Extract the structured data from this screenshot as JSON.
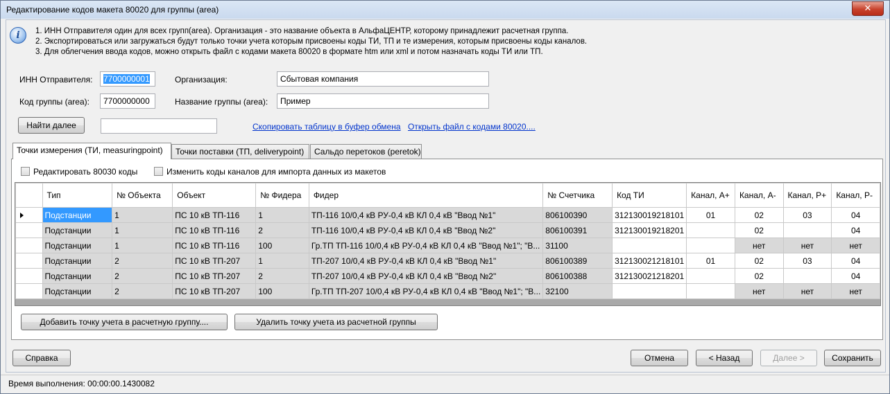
{
  "window": {
    "title": "Редактирование кодов макета 80020 для группы (area)",
    "close_glyph": "✕"
  },
  "info": {
    "icon": "info-icon",
    "icon_glyph": "i",
    "lines": [
      "1. ИНН Отправителя один для всех групп(area). Организация - это название объекта в АльфаЦЕНТР, которому принадлежит расчетная группа.",
      "2. Экспортироваться или загружаться будут только точки учета которым присвоены коды ТИ, ТП и те измерения, которым присвоены коды каналов.",
      "3. Для облегчения ввода кодов, можно открыть файл с кодами макета 80020 в формате htm или xml и потом назначать коды ТИ или ТП."
    ]
  },
  "form": {
    "inn_label": "ИНН Отправителя:",
    "inn_value": "7700000001",
    "org_label": "Организация:",
    "org_value": "Сбытовая компания",
    "area_code_label": "Код группы (area):",
    "area_code_value": "7700000000",
    "area_name_label": "Название группы (area):",
    "area_name_value": "Пример",
    "find_button": "Найти далее",
    "find_value": "",
    "copy_link": "Скопировать таблицу в буфер обмена",
    "open_link": "Открыть файл с кодами 80020...."
  },
  "tabs": [
    "Точки измерения (ТИ, measuringpoint)",
    "Точки поставки (ТП, deliverypoint)",
    "Сальдо перетоков (peretok)"
  ],
  "checkboxes": {
    "edit_80030": "Редактировать 80030 коды",
    "change_channel_codes": "Изменить коды каналов для импорта данных из макетов"
  },
  "table": {
    "columns": [
      "Тип",
      "№ Объекта",
      "Объект",
      "№ Фидера",
      "Фидер",
      "№ Счетчика",
      "Код ТИ",
      "Канал, А+",
      "Канал, А-",
      "Канал, Р+",
      "Канал, Р-"
    ],
    "rows": [
      [
        "Подстанции",
        "1",
        "ПС 10 кВ ТП-116",
        "1",
        "ТП-116 10/0,4 кВ РУ-0,4 кВ КЛ 0,4 кВ \"Ввод №1\"",
        "806100390",
        "312130019218101",
        "01",
        "02",
        "03",
        "04"
      ],
      [
        "Подстанции",
        "1",
        "ПС 10 кВ ТП-116",
        "2",
        "ТП-116 10/0,4 кВ РУ-0,4 кВ КЛ 0,4 кВ \"Ввод №2\"",
        "806100391",
        "312130019218201",
        "",
        "02",
        "",
        "04"
      ],
      [
        "Подстанции",
        "1",
        "ПС 10 кВ ТП-116",
        "100",
        "Гр.ТП ТП-116 10/0,4 кВ РУ-0,4 кВ КЛ 0,4 кВ \"Ввод №1\"; \"В...",
        "31100",
        "",
        "",
        "нет",
        "нет",
        "нет"
      ],
      [
        "Подстанции",
        "2",
        "ПС 10 кВ ТП-207",
        "1",
        "ТП-207 10/0,4 кВ РУ-0,4 кВ КЛ 0,4 кВ \"Ввод №1\"",
        "806100389",
        "312130021218101",
        "01",
        "02",
        "03",
        "04"
      ],
      [
        "Подстанции",
        "2",
        "ПС 10 кВ ТП-207",
        "2",
        "ТП-207 10/0,4 кВ РУ-0,4 кВ КЛ 0,4 кВ \"Ввод №2\"",
        "806100388",
        "312130021218201",
        "",
        "02",
        "",
        "04"
      ],
      [
        "Подстанции",
        "2",
        "ПС 10 кВ ТП-207",
        "100",
        "Гр.ТП ТП-207 10/0,4 кВ РУ-0,4 кВ КЛ 0,4 кВ \"Ввод №1\"; \"В...",
        "32100",
        "",
        "",
        "нет",
        "нет",
        "нет"
      ]
    ]
  },
  "actions": {
    "add_point": "Добавить точку учета в расчетную группу....",
    "remove_point": "Удалить точку учета из расчетной группы"
  },
  "footer": {
    "help": "Справка",
    "cancel": "Отмена",
    "back": "< Назад",
    "next": "Далее >",
    "save": "Сохранить"
  },
  "status": "Время выполнения: 00:00:00.1430082",
  "colors": {
    "selection": "#3399ff",
    "readonly_cell": "#d9d9d9",
    "link": "#0033cc"
  }
}
